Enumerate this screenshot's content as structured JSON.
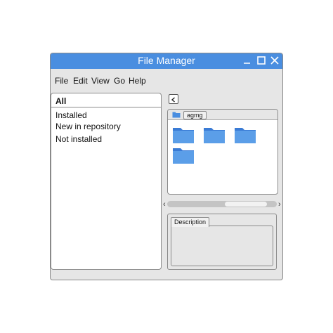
{
  "window": {
    "title": "File Manager",
    "accent": "#4a8ee0"
  },
  "menu": {
    "file": "File",
    "edit": "Edit",
    "view": "View",
    "go": "Go",
    "help": "Help"
  },
  "sidebar": {
    "header": "All",
    "items": [
      "Installed",
      "New in repository",
      "Not installed"
    ]
  },
  "breadcrumb": {
    "folder_label": "agmg"
  },
  "folders": {
    "count": 4,
    "color": "#4a8ee0"
  },
  "description": {
    "tab_label": "Description"
  }
}
